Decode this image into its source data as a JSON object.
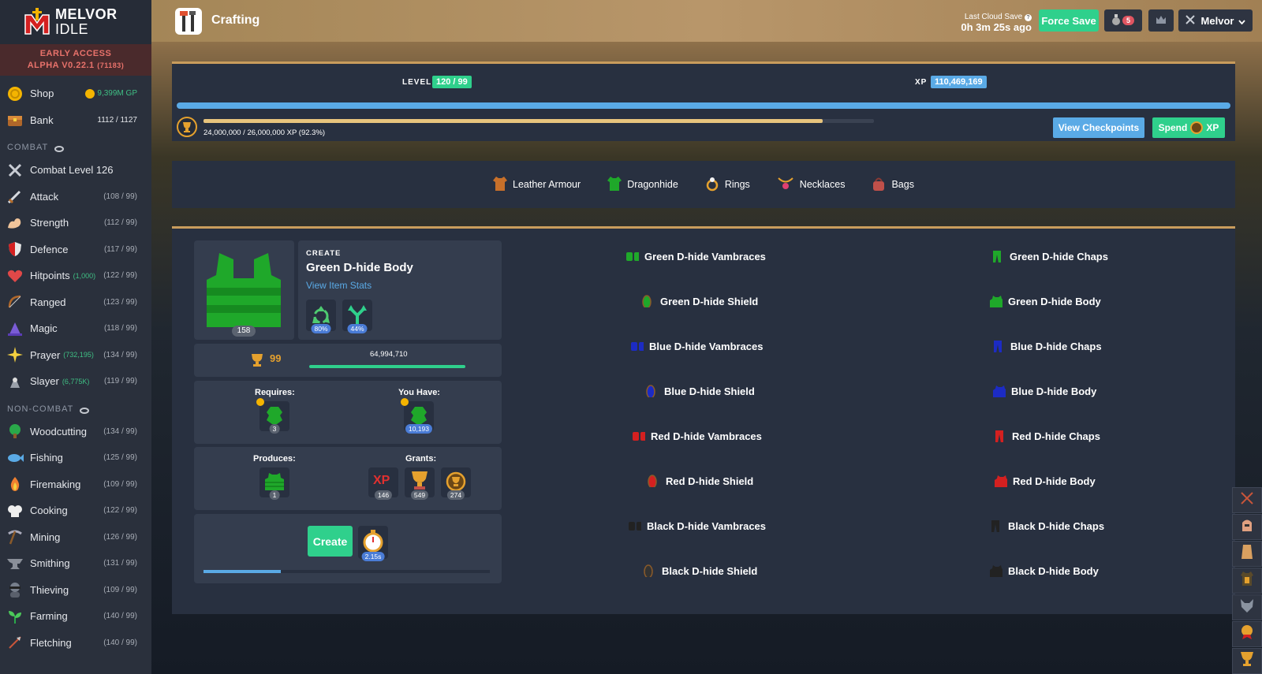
{
  "app": {
    "logo_line1": "MELVOR",
    "logo_line2": "IDLE",
    "early_access": "EARLY ACCESS",
    "version": "ALPHA V0.22.1",
    "build": "(71183)"
  },
  "sidebar": {
    "shop": {
      "label": "Shop",
      "gp": "9,399M GP"
    },
    "bank": {
      "label": "Bank",
      "count": "1112 / 1127"
    },
    "combat_header": "COMBAT",
    "combat": [
      {
        "label": "Combat Level 126",
        "level": "",
        "sub": ""
      },
      {
        "label": "Attack",
        "level": "(108 / 99)",
        "sub": ""
      },
      {
        "label": "Strength",
        "level": "(112 / 99)",
        "sub": ""
      },
      {
        "label": "Defence",
        "level": "(117 / 99)",
        "sub": ""
      },
      {
        "label": "Hitpoints",
        "level": "(122 / 99)",
        "sub": "(1,000)"
      },
      {
        "label": "Ranged",
        "level": "(123 / 99)",
        "sub": ""
      },
      {
        "label": "Magic",
        "level": "(118 / 99)",
        "sub": ""
      },
      {
        "label": "Prayer",
        "level": "(134 / 99)",
        "sub": "(732,195)"
      },
      {
        "label": "Slayer",
        "level": "(119 / 99)",
        "sub": "(6,775K)"
      }
    ],
    "noncombat_header": "NON-COMBAT",
    "noncombat": [
      {
        "label": "Woodcutting",
        "level": "(134 / 99)"
      },
      {
        "label": "Fishing",
        "level": "(125 / 99)"
      },
      {
        "label": "Firemaking",
        "level": "(109 / 99)"
      },
      {
        "label": "Cooking",
        "level": "(122 / 99)"
      },
      {
        "label": "Mining",
        "level": "(126 / 99)"
      },
      {
        "label": "Smithing",
        "level": "(131 / 99)"
      },
      {
        "label": "Thieving",
        "level": "(109 / 99)"
      },
      {
        "label": "Farming",
        "level": "(140 / 99)"
      },
      {
        "label": "Fletching",
        "level": "(140 / 99)"
      }
    ]
  },
  "header": {
    "page_title": "Crafting",
    "last_cloud_save_label": "Last Cloud Save",
    "last_cloud_save_time": "0h 3m 25s ago",
    "force_save": "Force Save",
    "potion_count": "5",
    "account": "Melvor"
  },
  "skill": {
    "level_label": "LEVEL",
    "level_value": "120 / 99",
    "xp_label": "XP",
    "xp_value": "110,469,169",
    "mastery_text": "24,000,000 / 26,000,000 XP (92.3%)",
    "mastery_pool_fraction": 0.923,
    "view_checkpoints": "View Checkpoints",
    "spend_left": "Spend",
    "spend_right": "XP"
  },
  "categories": [
    "Leather Armour",
    "Dragonhide",
    "Rings",
    "Necklaces",
    "Bags"
  ],
  "craft": {
    "item_count": "158",
    "create_label": "CREATE",
    "item_name": "Green D-hide Body",
    "view_stats": "View Item Stats",
    "preserve_pct": "80%",
    "double_pct": "44%",
    "mastery_level": "99",
    "mastery_xp": "64,994,710",
    "requires_label": "Requires:",
    "you_have_label": "You Have:",
    "requires_qty": "3",
    "have_qty": "10,193",
    "produces_label": "Produces:",
    "grants_label": "Grants:",
    "produces_qty": "1",
    "xp_icon_text": "XP",
    "grant_xp": "146",
    "grant_mastery": "549",
    "grant_pool": "274",
    "create_button": "Create",
    "interval": "2.15s"
  },
  "items_left": [
    "Green D-hide Vambraces",
    "Green D-hide Shield",
    "Blue D-hide Vambraces",
    "Blue D-hide Shield",
    "Red D-hide Vambraces",
    "Red D-hide Shield",
    "Black D-hide Vambraces",
    "Black D-hide Shield"
  ],
  "items_right": [
    "Green D-hide Chaps",
    "Green D-hide Body",
    "Blue D-hide Chaps",
    "Blue D-hide Body",
    "Red D-hide Chaps",
    "Red D-hide Body",
    "Black D-hide Chaps",
    "Black D-hide Body"
  ],
  "colors": {
    "accent_green": "#2fd08c",
    "accent_blue": "#5aaae6",
    "gold": "#e5a12e",
    "green_hide": "#1fa82a",
    "blue_hide": "#1c2bc4",
    "red_hide": "#d42020",
    "black_hide": "#222222"
  }
}
